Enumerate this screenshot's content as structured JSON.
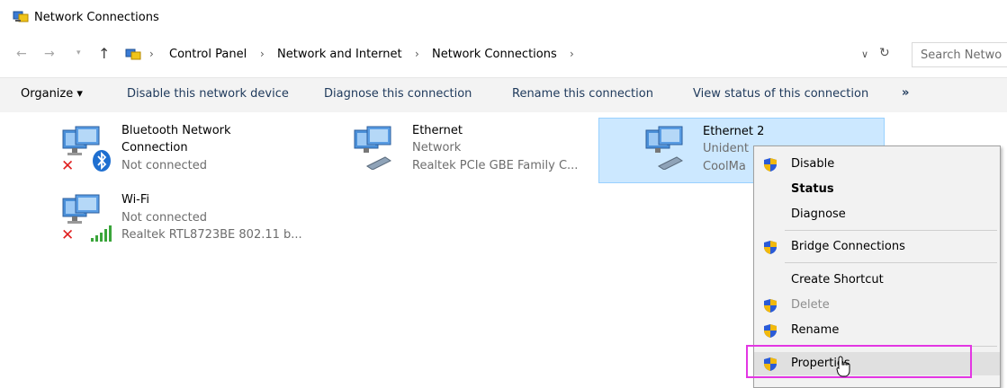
{
  "window": {
    "title": "Network Connections"
  },
  "address": {
    "crumbs": [
      "Control Panel",
      "Network and Internet",
      "Network Connections"
    ],
    "search_placeholder": "Search Netwo"
  },
  "toolbar": {
    "organize": "Organize ▾",
    "disable": "Disable this network device",
    "diagnose": "Diagnose this connection",
    "rename": "Rename this connection",
    "view_status": "View status of this connection",
    "more": "»"
  },
  "connections": [
    {
      "name": "Bluetooth Network",
      "name2": "Connection",
      "status": "Not connected",
      "device": ""
    },
    {
      "name": "Ethernet",
      "status": "Network",
      "device": "Realtek PCIe GBE Family C..."
    },
    {
      "name": "Ethernet 2",
      "status": "Unident",
      "device": "CoolMa"
    },
    {
      "name": "Wi-Fi",
      "status": "Not connected",
      "device": "Realtek RTL8723BE 802.11 b..."
    }
  ],
  "context_menu": {
    "items": [
      "Disable",
      "Status",
      "Diagnose",
      "Bridge Connections",
      "Create Shortcut",
      "Delete",
      "Rename",
      "Properties"
    ]
  },
  "colors": {
    "selection_bg": "#cce8ff",
    "highlight_border": "#e336e3",
    "toolbar_text": "#1e395b"
  }
}
